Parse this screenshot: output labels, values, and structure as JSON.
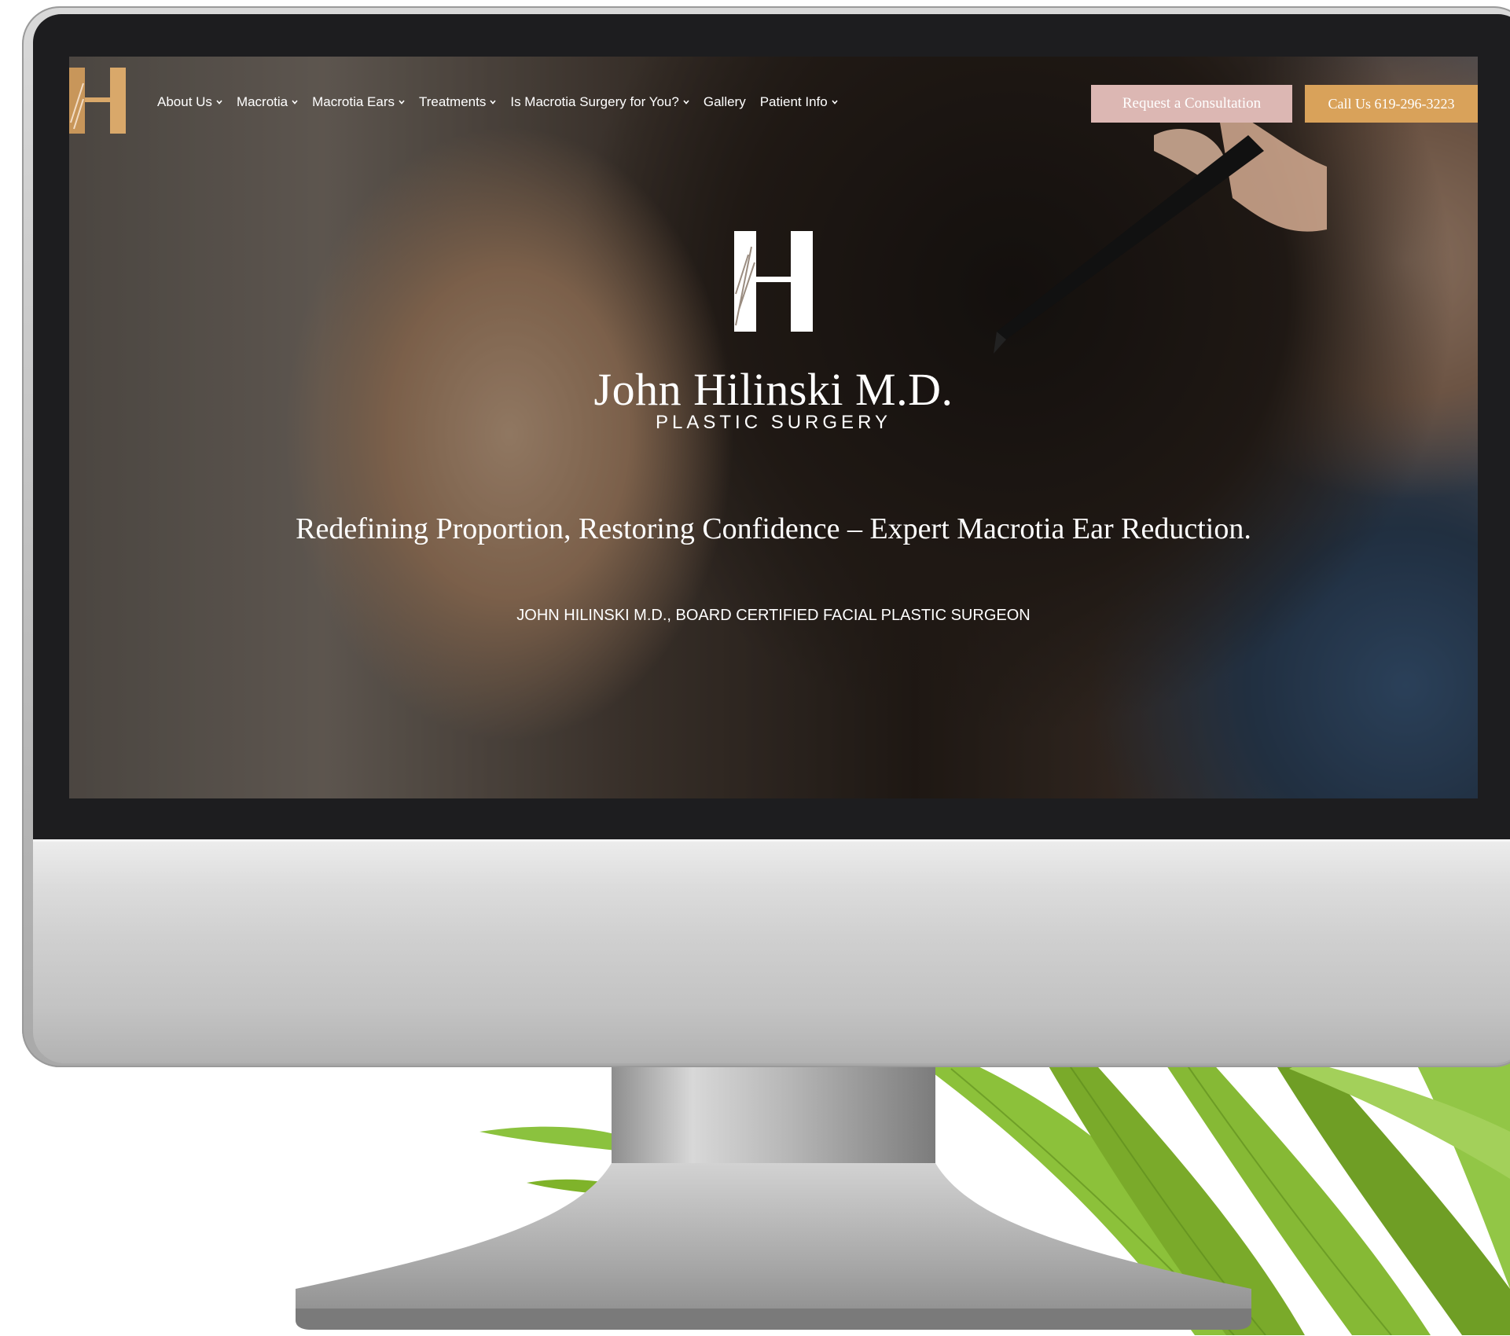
{
  "nav": {
    "items": [
      {
        "label": "About Us",
        "dropdown": true
      },
      {
        "label": "Macrotia",
        "dropdown": true
      },
      {
        "label": "Macrotia Ears",
        "dropdown": true
      },
      {
        "label": "Treatments",
        "dropdown": true
      },
      {
        "label": "Is Macrotia Surgery for You?",
        "dropdown": true
      },
      {
        "label": "Gallery",
        "dropdown": false
      },
      {
        "label": "Patient Info",
        "dropdown": true
      }
    ],
    "consult_label": "Request a Consultation",
    "call_label": "Call Us 619-296-3223"
  },
  "hero": {
    "brand_name": "John Hilinski M.D.",
    "brand_sub": "PLASTIC SURGERY",
    "tagline": "Redefining Proportion, Restoring Confidence – Expert Macrotia Ear Reduction.",
    "subline": "JOHN HILINSKI M.D., BOARD CERTIFIED FACIAL PLASTIC SURGEON"
  },
  "colors": {
    "consult_button": "#dcb7b3",
    "call_button": "#d9a25a",
    "logo_gold": "#c8965a"
  },
  "icons": {
    "nav_dropdown": "chevron-down-icon",
    "logo": "h-monogram-logo"
  }
}
